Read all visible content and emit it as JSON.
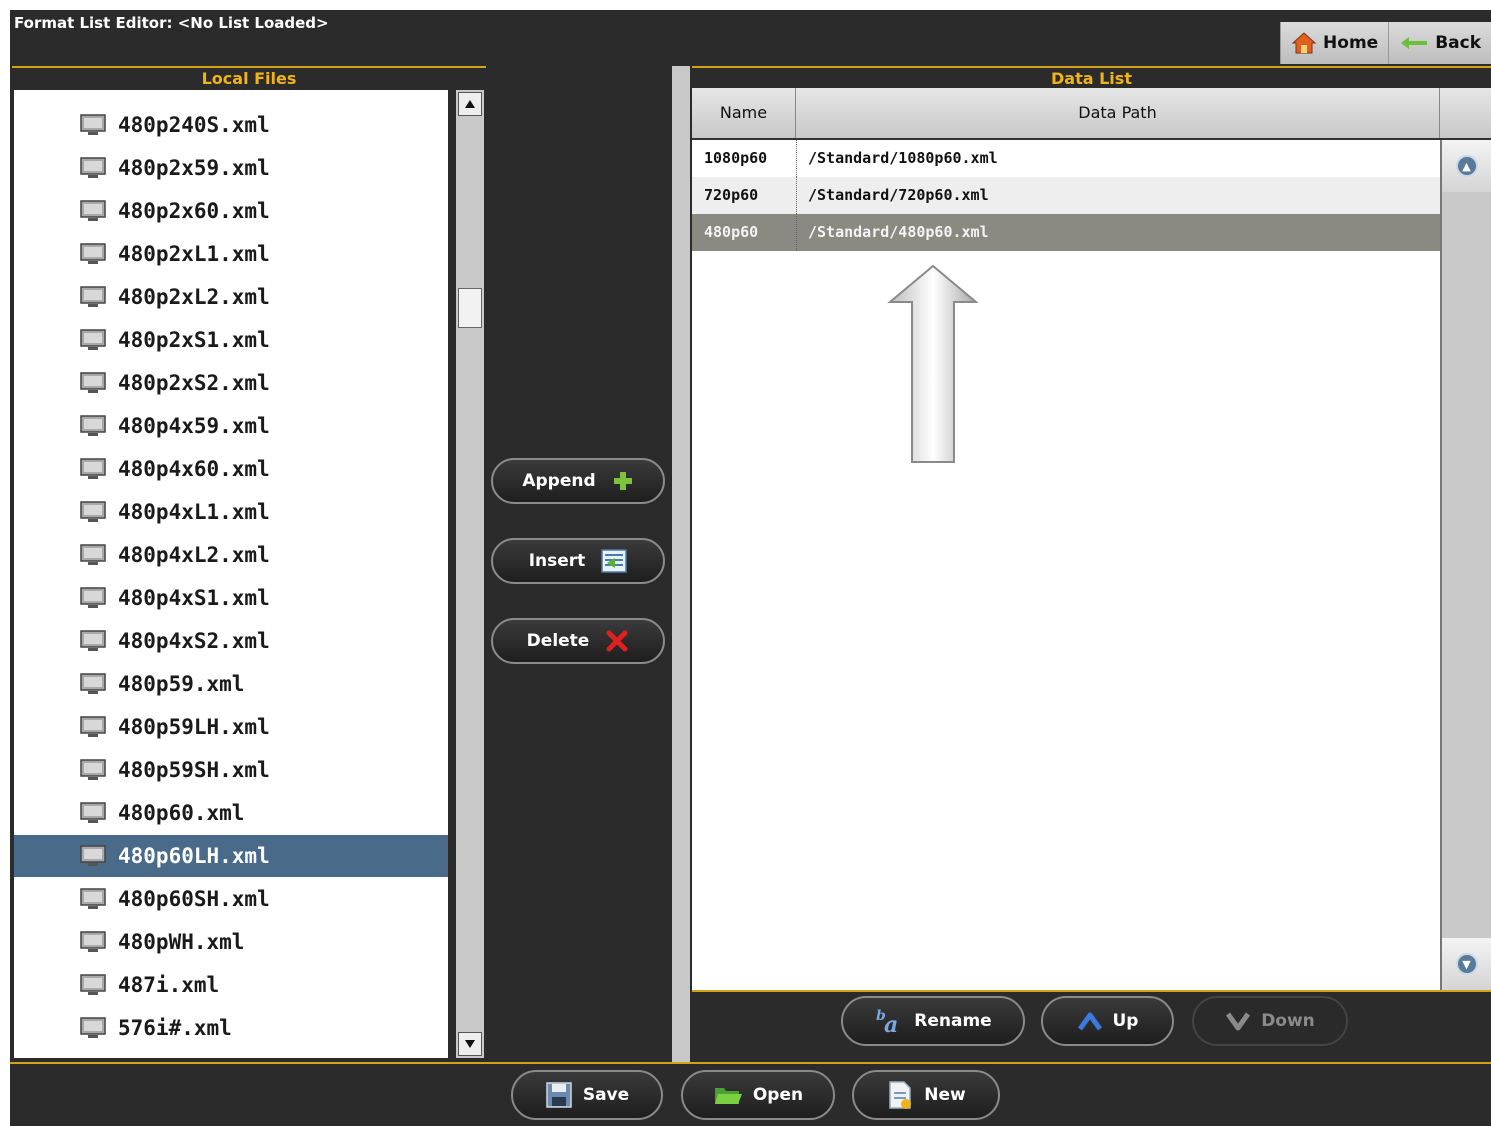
{
  "window": {
    "title": "Format List Editor: <No List Loaded>"
  },
  "nav": {
    "home": "Home",
    "back": "Back"
  },
  "local_files": {
    "header": "Local Files",
    "items": [
      "480p240S.xml",
      "480p2x59.xml",
      "480p2x60.xml",
      "480p2xL1.xml",
      "480p2xL2.xml",
      "480p2xS1.xml",
      "480p2xS2.xml",
      "480p4x59.xml",
      "480p4x60.xml",
      "480p4xL1.xml",
      "480p4xL2.xml",
      "480p4xS1.xml",
      "480p4xS2.xml",
      "480p59.xml",
      "480p59LH.xml",
      "480p59SH.xml",
      "480p60.xml",
      "480p60LH.xml",
      "480p60SH.xml",
      "480pWH.xml",
      "487i.xml",
      "576i#.xml"
    ],
    "selected": "480p60LH.xml"
  },
  "actions": {
    "append": "Append",
    "insert": "Insert",
    "delete": "Delete"
  },
  "data_list": {
    "header": "Data List",
    "columns": {
      "name": "Name",
      "path": "Data Path"
    },
    "rows": [
      {
        "name": "1080p60",
        "path": "/Standard/1080p60.xml"
      },
      {
        "name": "720p60",
        "path": "/Standard/720p60.xml"
      },
      {
        "name": "480p60",
        "path": "/Standard/480p60.xml"
      }
    ],
    "selected": "480p60"
  },
  "list_controls": {
    "rename": "Rename",
    "up": "Up",
    "down": "Down"
  },
  "file_controls": {
    "save": "Save",
    "open": "Open",
    "new": "New"
  },
  "colors": {
    "accent": "#f0b419",
    "selection_left": "#4a6a8a",
    "selection_right": "#8a8a82"
  }
}
